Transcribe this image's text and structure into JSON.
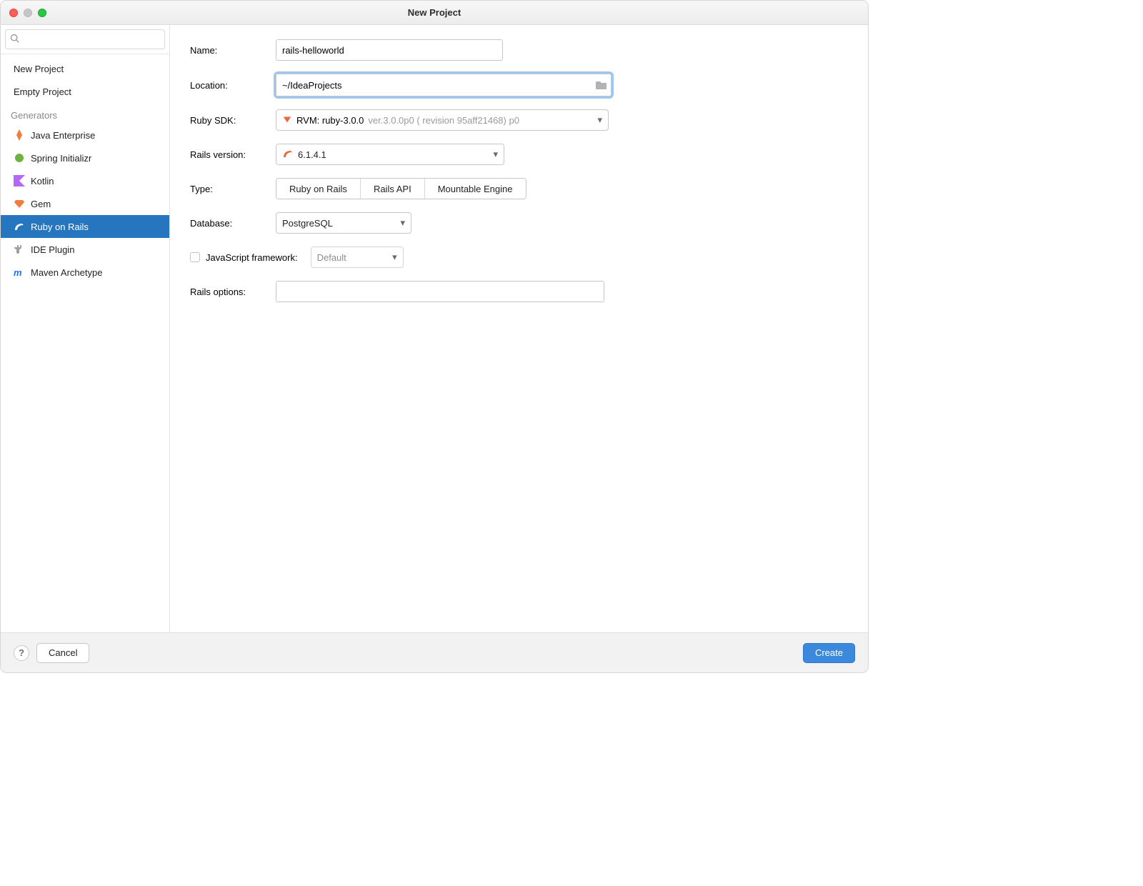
{
  "window": {
    "title": "New Project"
  },
  "sidebar": {
    "search_placeholder": "",
    "items_top": [
      {
        "label": "New Project"
      },
      {
        "label": "Empty Project"
      }
    ],
    "section_label": "Generators",
    "generators": [
      {
        "label": "Java Enterprise",
        "icon": "java-enterprise-icon",
        "selected": false
      },
      {
        "label": "Spring Initializr",
        "icon": "spring-icon",
        "selected": false
      },
      {
        "label": "Kotlin",
        "icon": "kotlin-icon",
        "selected": false
      },
      {
        "label": "Gem",
        "icon": "gem-icon",
        "selected": false
      },
      {
        "label": "Ruby on Rails",
        "icon": "rails-icon",
        "selected": true
      },
      {
        "label": "IDE Plugin",
        "icon": "plugin-icon",
        "selected": false
      },
      {
        "label": "Maven Archetype",
        "icon": "maven-icon",
        "selected": false
      }
    ]
  },
  "form": {
    "name_label": "Name:",
    "name_value": "rails-helloworld",
    "location_label": "Location:",
    "location_value": "~/IdeaProjects",
    "sdk_label": "Ruby SDK:",
    "sdk_main": "RVM: ruby-3.0.0",
    "sdk_meta": "ver.3.0.0p0 ( revision 95aff21468) p0",
    "rails_label": "Rails version:",
    "rails_value": "6.1.4.1",
    "type_label": "Type:",
    "type_options": [
      "Ruby on Rails",
      "Rails API",
      "Mountable Engine"
    ],
    "type_selected_index": 0,
    "db_label": "Database:",
    "db_value": "PostgreSQL",
    "js_label": "JavaScript framework:",
    "js_value": "Default",
    "js_enabled": false,
    "opts_label": "Rails options:",
    "opts_value": ""
  },
  "footer": {
    "cancel": "Cancel",
    "create": "Create",
    "help": "?"
  }
}
